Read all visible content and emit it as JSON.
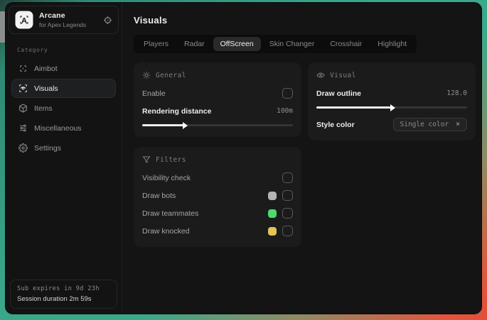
{
  "sidebar": {
    "logo_letter": "A",
    "app_name": "Arcane",
    "app_subtitle": "for Apex Legends",
    "category_label": "Category",
    "items": [
      {
        "label": "Aimbot",
        "icon": "crosshair-icon",
        "selected": false
      },
      {
        "label": "Visuals",
        "icon": "scan-eye-icon",
        "selected": true
      },
      {
        "label": "Items",
        "icon": "package-icon",
        "selected": false
      },
      {
        "label": "Miscellaneous",
        "icon": "sliders-icon",
        "selected": false
      },
      {
        "label": "Settings",
        "icon": "gear-icon",
        "selected": false
      }
    ],
    "footer": {
      "sub_expires": "Sub expires in 9d 23h",
      "session_duration": "Session duration 2m 59s"
    }
  },
  "main": {
    "title": "Visuals",
    "tabs": [
      {
        "label": "Players",
        "active": false
      },
      {
        "label": "Radar",
        "active": false
      },
      {
        "label": "OffScreen",
        "active": true
      },
      {
        "label": "Skin Changer",
        "active": false
      },
      {
        "label": "Crosshair",
        "active": false
      },
      {
        "label": "Highlight",
        "active": false
      }
    ],
    "general": {
      "title": "General",
      "enable_label": "Enable",
      "enable_checked": false,
      "distance_label": "Rendering distance",
      "distance_value": "100m",
      "slider_fill": "28%"
    },
    "visual": {
      "title": "Visual",
      "outline_label": "Draw outline",
      "outline_value": "128.0",
      "slider_fill": "50%",
      "style_color_label": "Style color",
      "style_color_value": "Single color",
      "clear_glyph": "×"
    },
    "filters": {
      "title": "Filters",
      "rows": [
        {
          "label": "Visibility check",
          "swatch": "",
          "checked": false
        },
        {
          "label": "Draw bots",
          "swatch": "#b3b3b3",
          "checked": false
        },
        {
          "label": "Draw teammates",
          "swatch": "#4dd96f",
          "checked": false
        },
        {
          "label": "Draw knocked",
          "swatch": "#e3c455",
          "checked": false
        }
      ]
    }
  },
  "colors": {
    "desktop_teal": "#3aa98b",
    "desktop_orange": "#e25038",
    "window_bg": "#141415",
    "card_bg": "#1b1b1c",
    "accent_text": "#ececec"
  }
}
